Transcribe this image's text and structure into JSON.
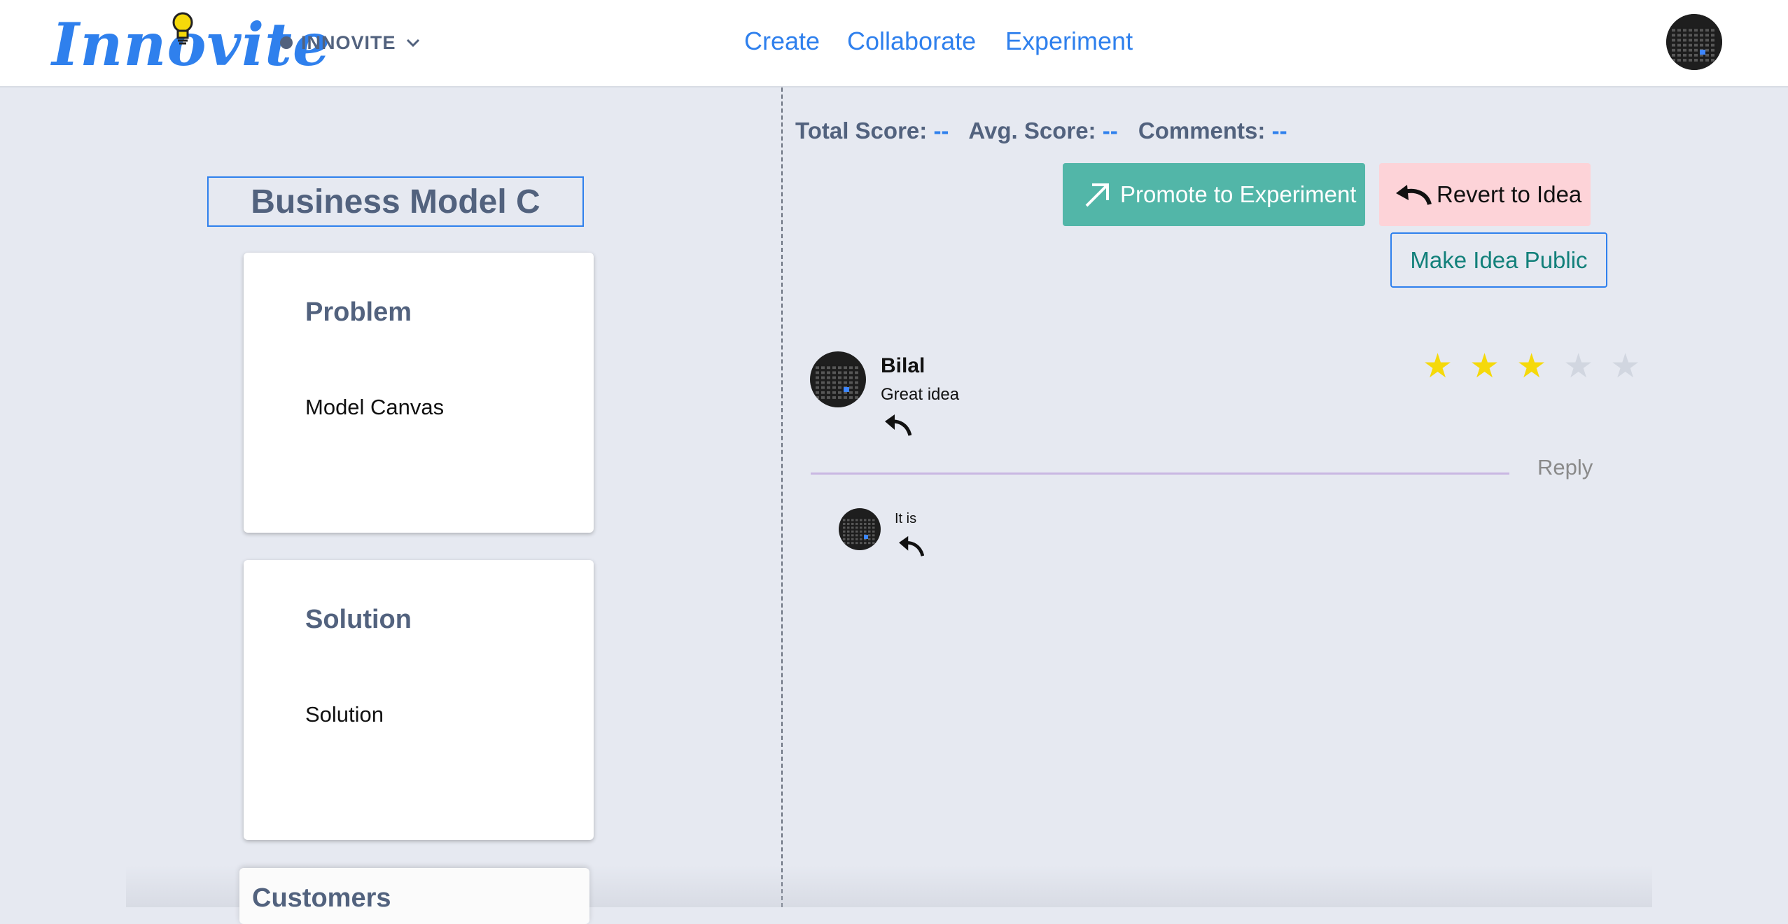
{
  "header": {
    "logo": "Innovite",
    "workspace": "INNOVITE",
    "nav": [
      "Create",
      "Collaborate",
      "Experiment"
    ]
  },
  "canvas": {
    "title": "Business Model C",
    "cards": [
      {
        "title": "Problem",
        "body": "Model Canvas"
      },
      {
        "title": "Solution",
        "body": "Solution"
      },
      {
        "title": "Customers"
      }
    ]
  },
  "scores": {
    "total_label": "Total Score:",
    "total_value": "--",
    "avg_label": "Avg. Score:",
    "avg_value": "--",
    "comments_label": "Comments:",
    "comments_value": "--"
  },
  "actions": {
    "promote": "Promote to Experiment",
    "revert": "Revert to Idea",
    "make_public": "Make Idea Public"
  },
  "comment": {
    "author": "Bilal",
    "text": "Great idea",
    "rating": 3,
    "rating_max": 5,
    "reply_label": "Reply",
    "replies": [
      {
        "text": "It is"
      }
    ]
  },
  "colors": {
    "accent": "#2f80ed",
    "muted_heading": "#52627e",
    "promote_bg": "#52b6a8",
    "revert_bg": "#fdd3d8",
    "star_on": "#f5d90a",
    "star_off": "#d1d6e0"
  }
}
